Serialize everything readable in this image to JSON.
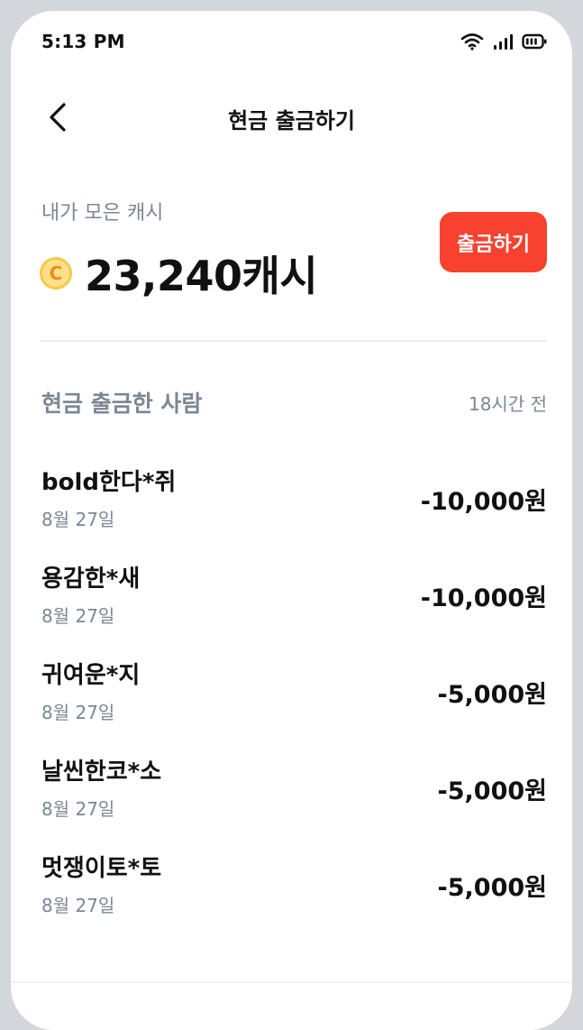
{
  "status_bar": {
    "time": "5:13 PM",
    "icons": [
      "wifi-icon",
      "signal-icon",
      "battery-icon"
    ]
  },
  "header": {
    "back_icon": "chevron-left-icon",
    "title": "현금 출금하기"
  },
  "cash": {
    "label": "내가 모은 캐시",
    "coin_letter": "C",
    "amount": "23,240캐시",
    "withdraw_label": "출금하기"
  },
  "withdrawals": {
    "title": "현금 출금한 사람",
    "updated": "18시간 전",
    "items": [
      {
        "name": "bold한다*쥐",
        "date": "8월 27일",
        "amount": "-10,000원"
      },
      {
        "name": "용감한*새",
        "date": "8월 27일",
        "amount": "-10,000원"
      },
      {
        "name": "귀여운*지",
        "date": "8월 27일",
        "amount": "-5,000원"
      },
      {
        "name": "날씬한코*소",
        "date": "8월 27일",
        "amount": "-5,000원"
      },
      {
        "name": "멋쟁이토*토",
        "date": "8월 27일",
        "amount": "-5,000원"
      }
    ]
  },
  "colors": {
    "accent": "#f8412e",
    "muted_text": "#7b8794",
    "coin_fill": "#ffe08a",
    "coin_text": "#f08a1c"
  }
}
